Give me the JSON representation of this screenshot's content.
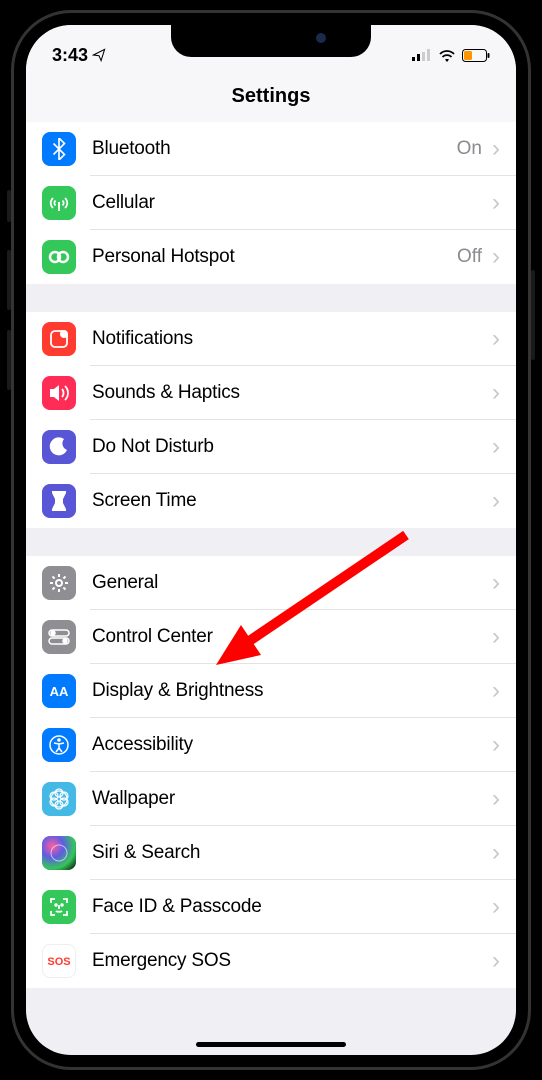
{
  "status": {
    "time": "3:43",
    "signal_bars": 2,
    "battery_low": true
  },
  "header": {
    "title": "Settings"
  },
  "groups": [
    {
      "rows": [
        {
          "icon": "bluetooth",
          "icon_bg": "#007aff",
          "label": "Bluetooth",
          "value": "On"
        },
        {
          "icon": "cellular",
          "icon_bg": "#34c759",
          "label": "Cellular",
          "value": ""
        },
        {
          "icon": "hotspot",
          "icon_bg": "#34c759",
          "label": "Personal Hotspot",
          "value": "Off"
        }
      ]
    },
    {
      "rows": [
        {
          "icon": "notifications",
          "icon_bg": "#ff3b30",
          "label": "Notifications",
          "value": ""
        },
        {
          "icon": "sounds",
          "icon_bg": "#ff2d55",
          "label": "Sounds & Haptics",
          "value": ""
        },
        {
          "icon": "dnd",
          "icon_bg": "#5856d6",
          "label": "Do Not Disturb",
          "value": ""
        },
        {
          "icon": "screentime",
          "icon_bg": "#5856d6",
          "label": "Screen Time",
          "value": ""
        }
      ]
    },
    {
      "rows": [
        {
          "icon": "general",
          "icon_bg": "#8e8e93",
          "label": "General",
          "value": ""
        },
        {
          "icon": "controlcenter",
          "icon_bg": "#8e8e93",
          "label": "Control Center",
          "value": ""
        },
        {
          "icon": "display",
          "icon_bg": "#007aff",
          "label": "Display & Brightness",
          "value": ""
        },
        {
          "icon": "accessibility",
          "icon_bg": "#007aff",
          "label": "Accessibility",
          "value": ""
        },
        {
          "icon": "wallpaper",
          "icon_bg": "#45b9e5",
          "label": "Wallpaper",
          "value": ""
        },
        {
          "icon": "siri",
          "icon_bg": "#000000",
          "label": "Siri & Search",
          "value": ""
        },
        {
          "icon": "faceid",
          "icon_bg": "#34c759",
          "label": "Face ID & Passcode",
          "value": ""
        },
        {
          "icon": "sos",
          "icon_bg": "#ffffff",
          "label": "Emergency SOS",
          "value": ""
        }
      ]
    }
  ],
  "annotation": {
    "arrow_color": "#ff0000",
    "target": "General"
  }
}
